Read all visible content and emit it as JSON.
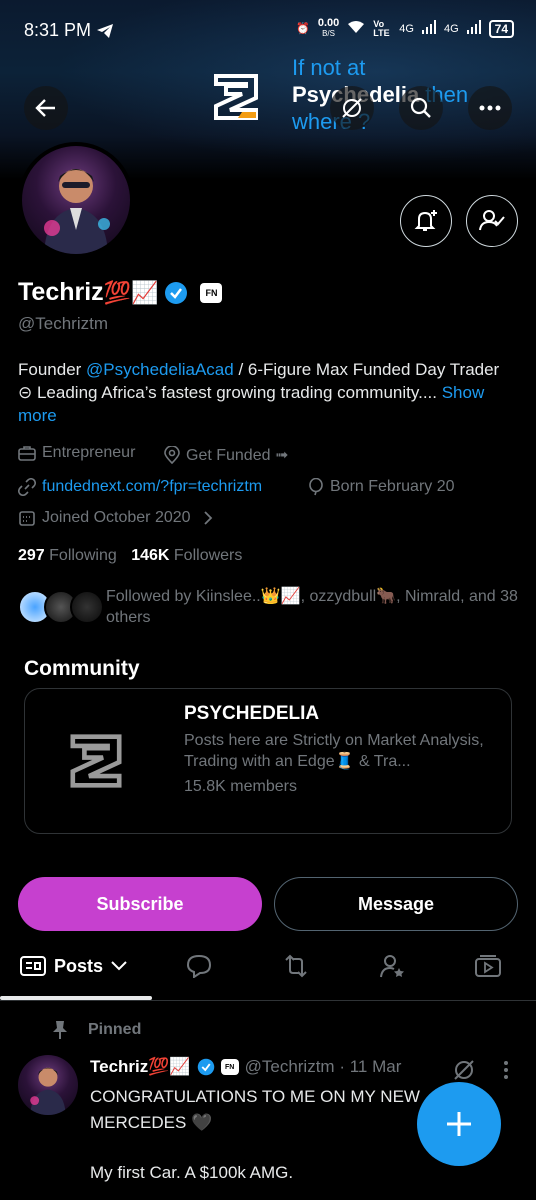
{
  "status_bar": {
    "time": "8:31 PM",
    "net_speed": "0.00",
    "net_unit": "B/S",
    "volte": "Vo LTE",
    "signal1": "4G",
    "signal2": "4G",
    "battery": "74"
  },
  "banner": {
    "line1": "If not at",
    "line2_bold": "Psychedelia",
    "line2_rest": " then",
    "line3": "where ?"
  },
  "profile": {
    "name": "Techriz",
    "name_emojis": "💯📈",
    "badge": "FN",
    "handle": "@Techriztm",
    "bio_prefix": "Founder ",
    "bio_mention": "@PsychedeliaAcad",
    "bio_rest": " / 6-Figure Max Funded Day Trader ⊝ Leading Africa’s fastest growing trading community.... ",
    "bio_show_more": "Show more",
    "category": "Entrepreneur",
    "location": "Get Funded ➟",
    "website": "fundednext.com/?fpr=techriztm",
    "born": "Born February 20",
    "joined": "Joined October 2020",
    "following_count": "297",
    "following_label": "Following",
    "followers_count": "146K",
    "followers_label": "Followers",
    "followed_by": "Followed by Kiinslee..👑📈, ozzydbull🐂, Nimrald, and 38 others"
  },
  "community": {
    "section_title": "Community",
    "name": "PSYCHEDELIA",
    "description": "Posts here are Strictly on Market Analysis, Trading with an Edge🧵 & Tra...",
    "members": "15.8K members"
  },
  "actions": {
    "subscribe": "Subscribe",
    "message": "Message"
  },
  "tabs": {
    "posts": "Posts"
  },
  "post": {
    "pinned_label": "Pinned",
    "author": "Techriz",
    "author_emojis": "💯📈",
    "badge": "FN",
    "handle_date": "@Techriztm · 11 Mar",
    "text_line1": "CONGRATULATIONS TO ME ON MY NEW MERCEDES 🖤",
    "text_line2": "My first Car. A $100k AMG."
  },
  "colors": {
    "accent": "#1d9bf0",
    "subscribe": "#c640cf",
    "background": "#000000",
    "muted": "#71767b"
  }
}
